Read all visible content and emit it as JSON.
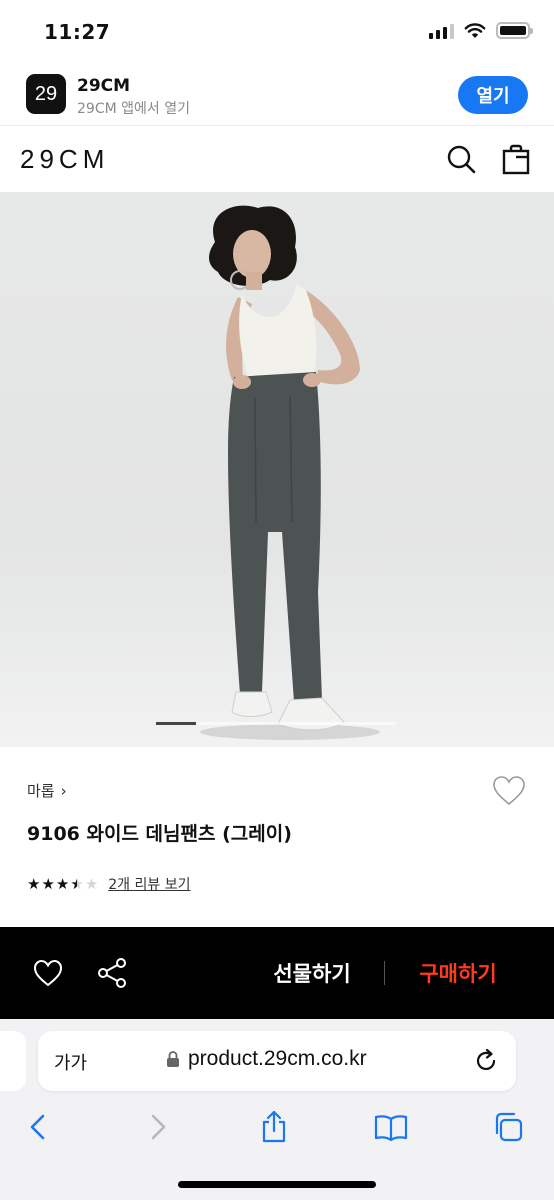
{
  "status_bar": {
    "time": "11:27"
  },
  "app_banner": {
    "icon_text": "29",
    "app_name": "29CM",
    "subtitle": "29CM 앱에서 열기",
    "open_label": "열기"
  },
  "header": {
    "logo": "29CM",
    "icons": [
      "search-icon",
      "shopping-bag-icon"
    ]
  },
  "product": {
    "image_pager": {
      "current": 1,
      "total": 6
    },
    "brand": "마롭",
    "brand_chevron": "›",
    "title": "9106 와이드 데님팬츠 (그레이)",
    "rating": 3.5,
    "rating_max": 5,
    "review_link": "2개 리뷰 보기"
  },
  "purchase_bar": {
    "gift_label": "선물하기",
    "buy_label": "구매하기",
    "icons": [
      "heart-icon",
      "share-icon"
    ]
  },
  "browser": {
    "aa_label": "가가",
    "url": "product.29cm.co.kr",
    "toolbar_icons": [
      "back-icon",
      "forward-icon",
      "share-icon",
      "bookmarks-icon",
      "tabs-icon"
    ]
  },
  "colors": {
    "banner_button": "#1877f2",
    "buy_text": "#ff3b1f",
    "purchase_bar_bg": "#000000",
    "browser_accent": "#1877f2"
  }
}
